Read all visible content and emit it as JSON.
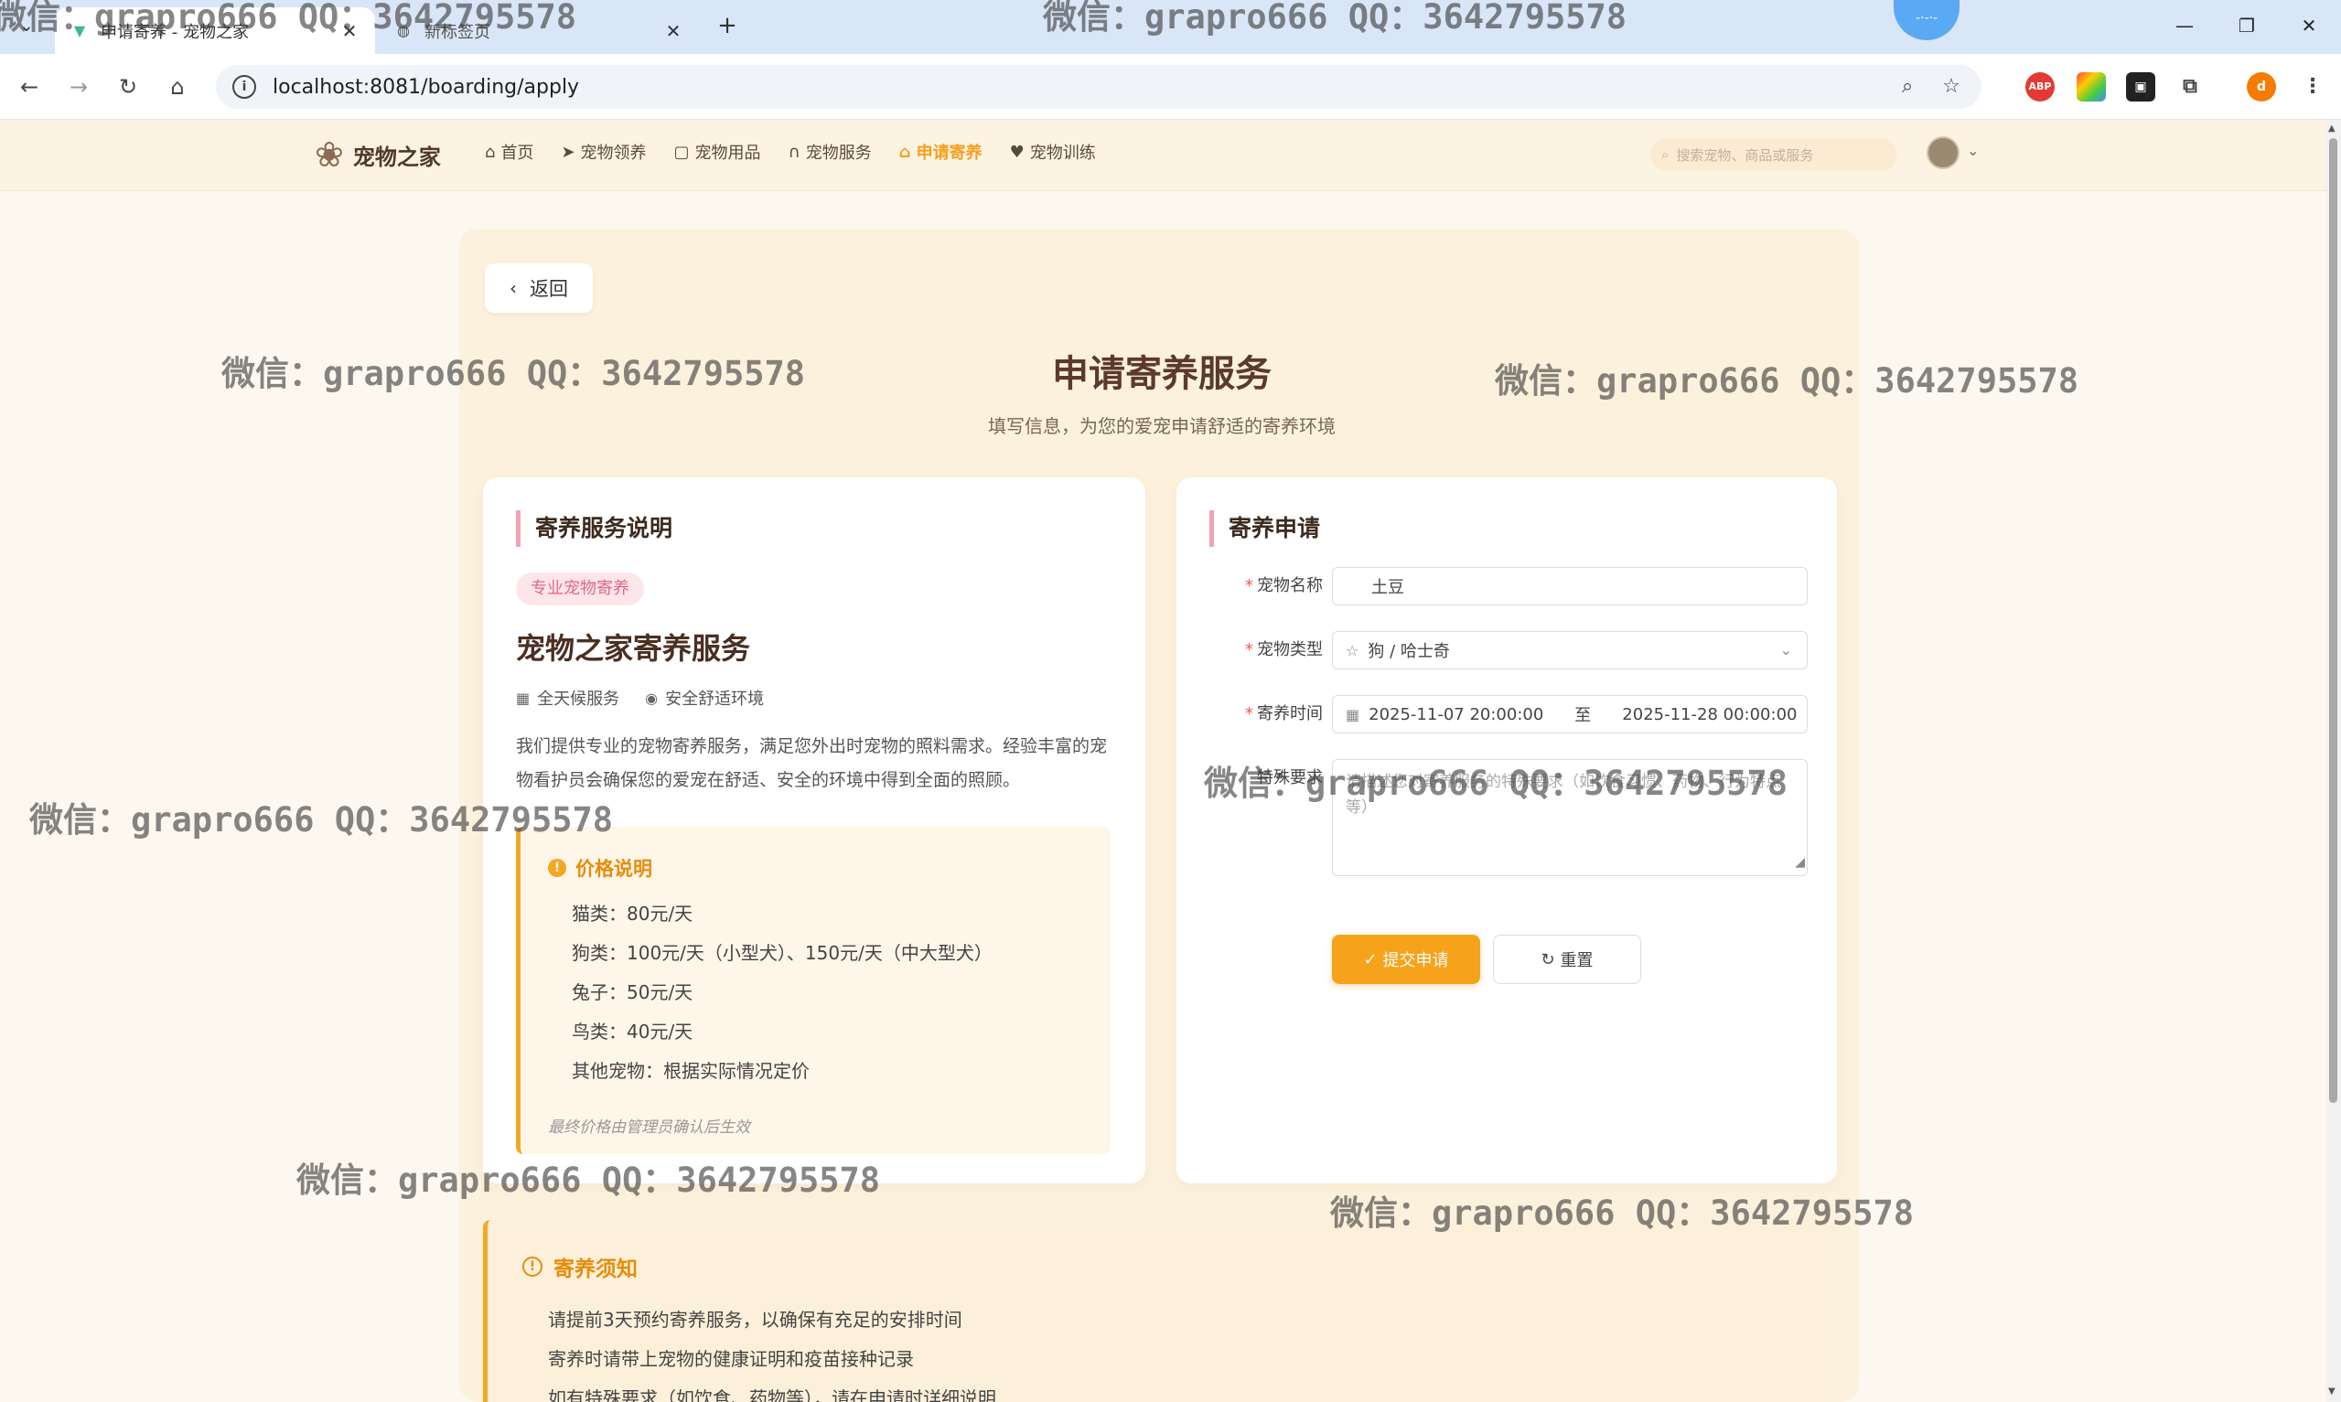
{
  "browser": {
    "tabs": [
      {
        "title": "申请寄养 - 宠物之家",
        "active": true,
        "favicon": "vue-icon"
      },
      {
        "title": "新标签页",
        "active": false,
        "favicon": "globe-icon"
      }
    ],
    "new_tab": "+",
    "url": "localhost:8081/boarding/apply",
    "profile_initial": "d",
    "extensions": [
      "ABP",
      "color-extension",
      "puzzle-extension"
    ]
  },
  "site": {
    "brand": "宠物之家",
    "nav": [
      {
        "label": "首页",
        "icon": "home-icon",
        "active": false
      },
      {
        "label": "宠物领养",
        "icon": "send-icon",
        "active": false
      },
      {
        "label": "宠物用品",
        "icon": "bag-icon",
        "active": false
      },
      {
        "label": "宠物服务",
        "icon": "headset-icon",
        "active": false
      },
      {
        "label": "申请寄养",
        "icon": "house-icon",
        "active": true
      },
      {
        "label": "宠物训练",
        "icon": "trophy-icon",
        "active": false
      }
    ],
    "search_placeholder": "搜索宠物、商品或服务"
  },
  "page": {
    "back_label": "返回",
    "title": "申请寄养服务",
    "subtitle": "填写信息，为您的爱宠申请舒适的寄养环境"
  },
  "info_card": {
    "heading": "寄养服务说明",
    "tag": "专业宠物寄养",
    "service_title": "宠物之家寄养服务",
    "features": [
      "全天候服务",
      "安全舒适环境"
    ],
    "description": "我们提供专业的宠物寄养服务，满足您外出时宠物的照料需求。经验丰富的宠物看护员会确保您的爱宠在舒适、安全的环境中得到全面的照顾。",
    "price": {
      "heading": "价格说明",
      "items": [
        "猫类：80元/天",
        "狗类：100元/天（小型犬）、150元/天（中大型犬）",
        "兔子：50元/天",
        "鸟类：40元/天",
        "其他宠物：根据实际情况定价"
      ],
      "note": "最终价格由管理员确认后生效"
    }
  },
  "form": {
    "heading": "寄养申请",
    "pet_name": {
      "label": "宠物名称",
      "value": "土豆"
    },
    "pet_type": {
      "label": "宠物类型",
      "value": "狗 / 哈士奇"
    },
    "period": {
      "label": "寄养时间",
      "start": "2025-11-07 20:00:00",
      "separator": "至",
      "end": "2025-11-28 00:00:00"
    },
    "special": {
      "label": "特殊要求",
      "placeholder": "请描述您对寄养服务的特殊要求（如饮食习惯、药物、行为特点等）"
    },
    "submit_label": "提交申请",
    "reset_label": "重置"
  },
  "notice": {
    "heading": "寄养须知",
    "items": [
      "请提前3天预约寄养服务，以确保有充足的安排时间",
      "寄养时请带上宠物的健康证明和疫苗接种记录",
      "如有特殊要求（如饮食、药物等），请在申请时详细说明"
    ]
  },
  "watermark": "微信：grapro666 QQ：3642795578",
  "colors": {
    "accent": "#f7a21b",
    "brand_text": "#5b3a2c",
    "pink_bar": "#f2a2b6",
    "page_bg": "#fdf8ef"
  }
}
